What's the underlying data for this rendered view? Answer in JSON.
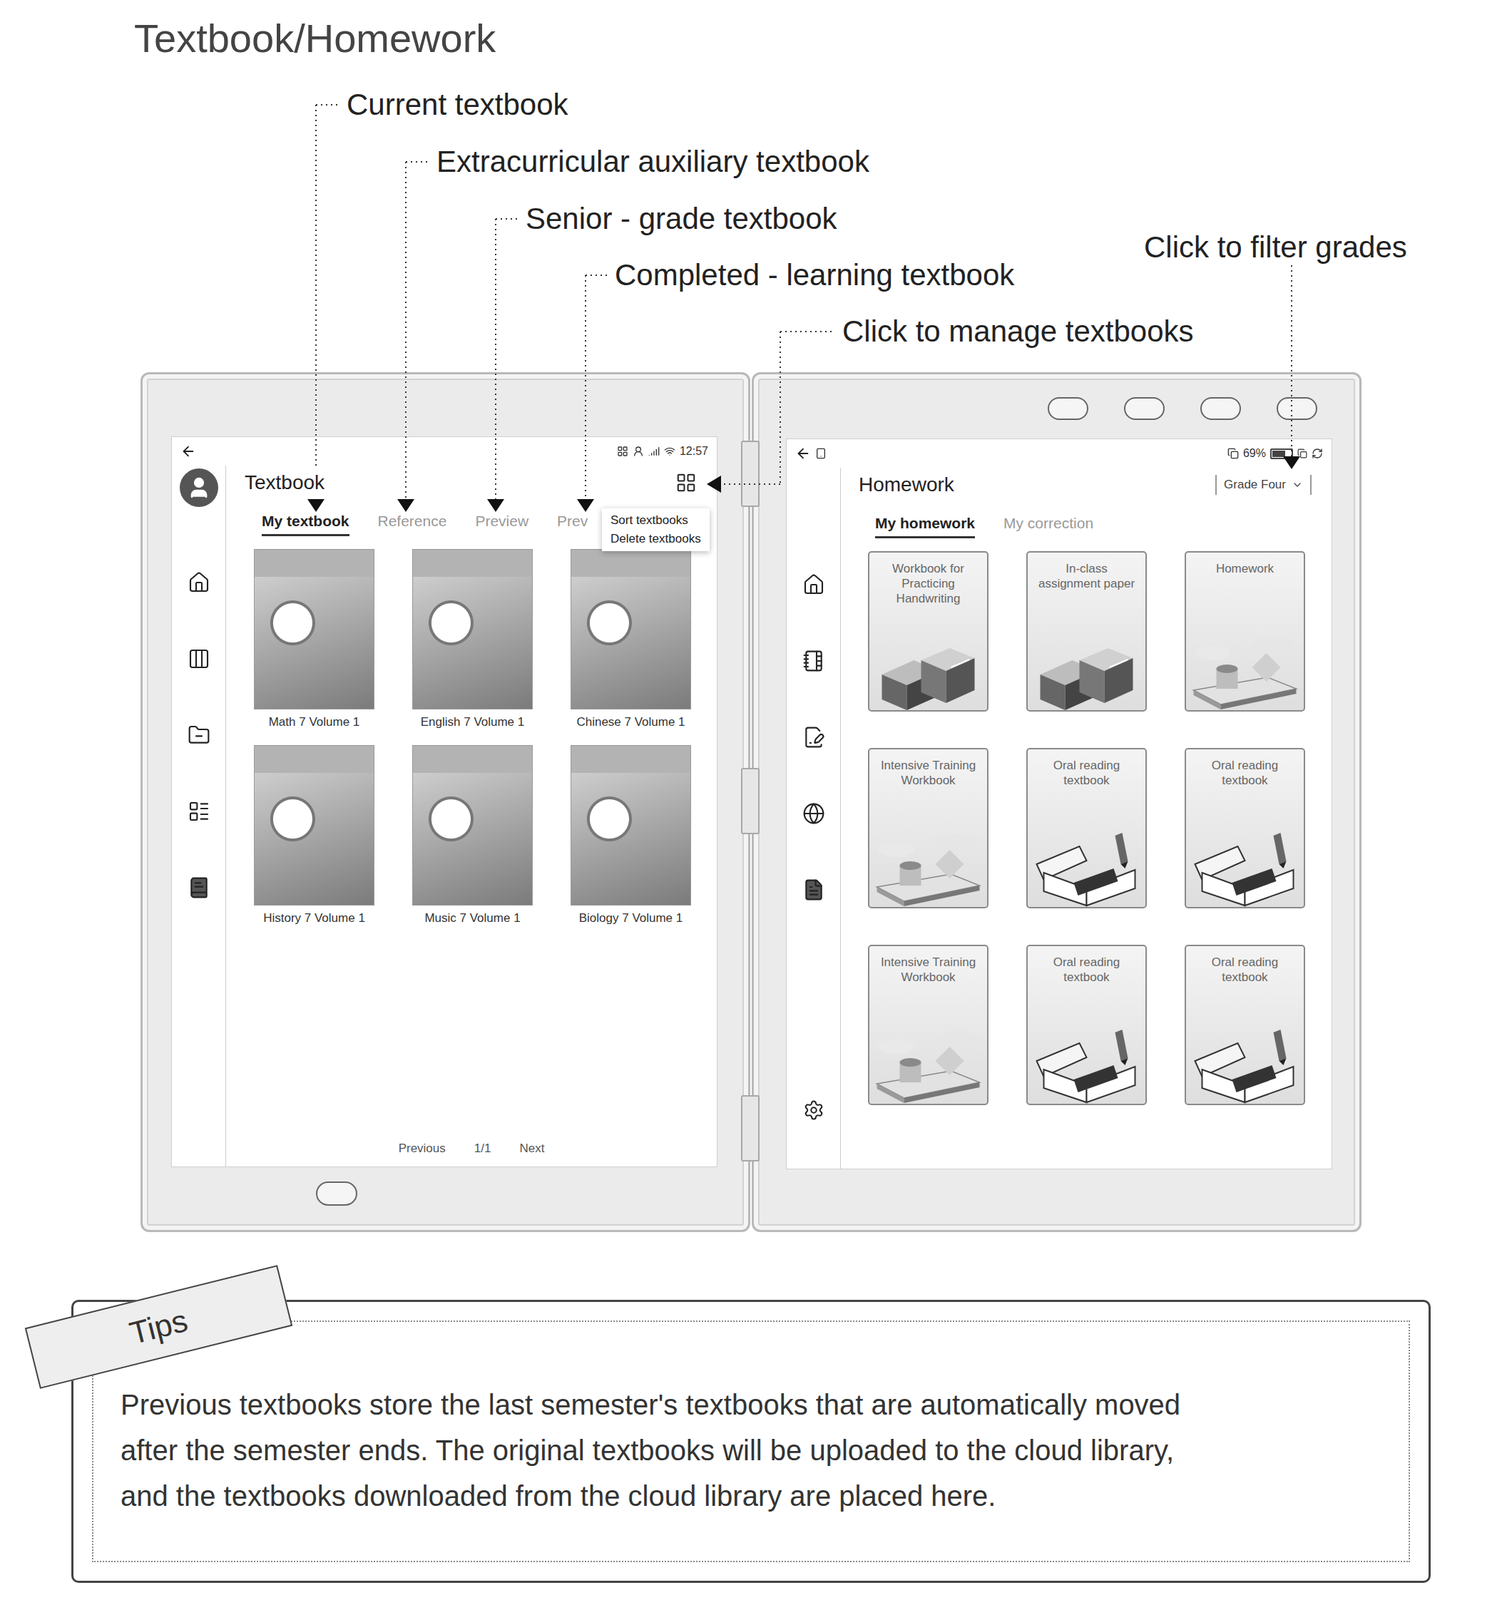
{
  "title": "Textbook/Homework",
  "annotations": [
    {
      "label": "Current textbook"
    },
    {
      "label": "Extracurricular auxiliary textbook"
    },
    {
      "label": "Senior - grade textbook"
    },
    {
      "label": "Completed - learning textbook"
    },
    {
      "label": "Click to manage textbooks"
    },
    {
      "label": "Click to filter grades"
    }
  ],
  "textbook_screen": {
    "status_bar": {
      "time": "12:57"
    },
    "sidebar": {
      "items": [
        {
          "selected": false
        },
        {
          "selected": false
        },
        {
          "selected": false
        },
        {
          "selected": false
        },
        {
          "selected": true
        }
      ]
    },
    "header": "Textbook",
    "tabs": [
      {
        "label": "My textbook",
        "selected": true
      },
      {
        "label": "Reference",
        "selected": false
      },
      {
        "label": "Preview",
        "selected": false
      },
      {
        "label": "Prev",
        "selected": false
      }
    ],
    "menu": {
      "items": [
        "Sort textbooks",
        "Delete textbooks"
      ]
    },
    "books": [
      {
        "caption": "Math 7 Volume 1"
      },
      {
        "caption": "English 7 Volume 1"
      },
      {
        "caption": "Chinese 7 Volume 1"
      },
      {
        "caption": "History 7 Volume 1"
      },
      {
        "caption": "Music 7 Volume 1"
      },
      {
        "caption": "Biology 7 Volume 1"
      }
    ],
    "pagination": {
      "previous": "Previous",
      "page": "1/1",
      "next": "Next"
    }
  },
  "homework_screen": {
    "status_bar": {
      "battery": "69%",
      "level": 0.69
    },
    "sidebar": {
      "items": [
        {
          "selected": false
        },
        {
          "selected": false
        },
        {
          "selected": false
        },
        {
          "selected": false
        },
        {
          "selected": true
        }
      ]
    },
    "header": "Homework",
    "grade_filter": "Grade Four",
    "tabs": [
      {
        "label": "My homework",
        "selected": true
      },
      {
        "label": "My correction",
        "selected": false
      }
    ],
    "cards": [
      {
        "title": "Workbook for Practicing Handwriting",
        "kind": "stairs"
      },
      {
        "title": "In-class assignment paper",
        "kind": "stairs"
      },
      {
        "title": "Homework",
        "kind": "clouds"
      },
      {
        "title": "Intensive Training Workbook",
        "kind": "clouds"
      },
      {
        "title": "Oral reading textbook",
        "kind": "reading"
      },
      {
        "title": "Oral reading textbook",
        "kind": "reading"
      },
      {
        "title": "Intensive Training Workbook",
        "kind": "clouds"
      },
      {
        "title": "Oral reading textbook",
        "kind": "reading"
      },
      {
        "title": "Oral reading textbook",
        "kind": "reading"
      }
    ]
  },
  "tips": {
    "label": "Tips",
    "lines": [
      "Previous textbooks store the last semester's textbooks that are automatically moved",
      "after the semester ends. The original textbooks will be uploaded to the cloud library,",
      "and the textbooks downloaded from the cloud library are placed here."
    ]
  }
}
